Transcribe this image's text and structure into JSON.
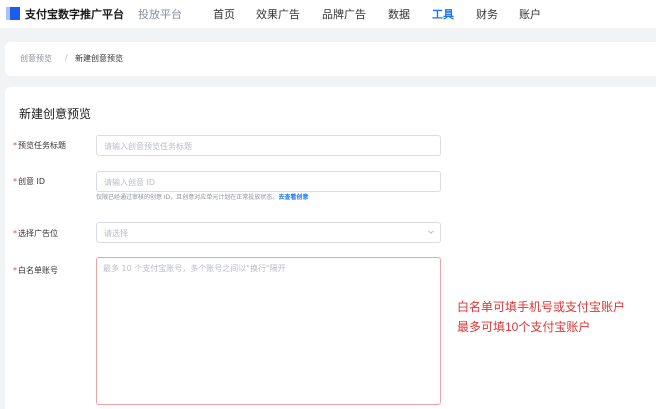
{
  "header": {
    "brand": "支付宝数字推广平台",
    "platform": "投放平台",
    "nav": [
      {
        "label": "首页",
        "active": false
      },
      {
        "label": "效果广告",
        "active": false
      },
      {
        "label": "品牌广告",
        "active": false
      },
      {
        "label": "数据",
        "active": false
      },
      {
        "label": "工具",
        "active": true
      },
      {
        "label": "财务",
        "active": false
      },
      {
        "label": "账户",
        "active": false
      }
    ],
    "accent_color": "#1677ff"
  },
  "breadcrumb": {
    "parent": "创意预览",
    "separator": "/",
    "current": "新建创意预览"
  },
  "form": {
    "title": "新建创意预览",
    "required_mark": "*",
    "task_title": {
      "label": "预览任务标题",
      "placeholder": "请输入创意预览任务标题"
    },
    "creative_id": {
      "label": "创意 ID",
      "placeholder": "请输入创意 ID",
      "hint": "仅限已经通过审核的创意 ID，且创意对应单元计划在正常投放状态。",
      "hint_link": "去查看创意"
    },
    "ad_slot": {
      "label": "选择广告位",
      "placeholder": "请选择",
      "icon": "chevron-down-icon"
    },
    "whitelist": {
      "label": "白名单账号",
      "placeholder": "最多 10 个支付宝账号，多个账号之间以\"换行\"隔开"
    }
  },
  "annotation": {
    "line1": "白名单可填手机号或支付宝账户",
    "line2": "最多可填10个支付宝账户",
    "color": "#e03434"
  }
}
